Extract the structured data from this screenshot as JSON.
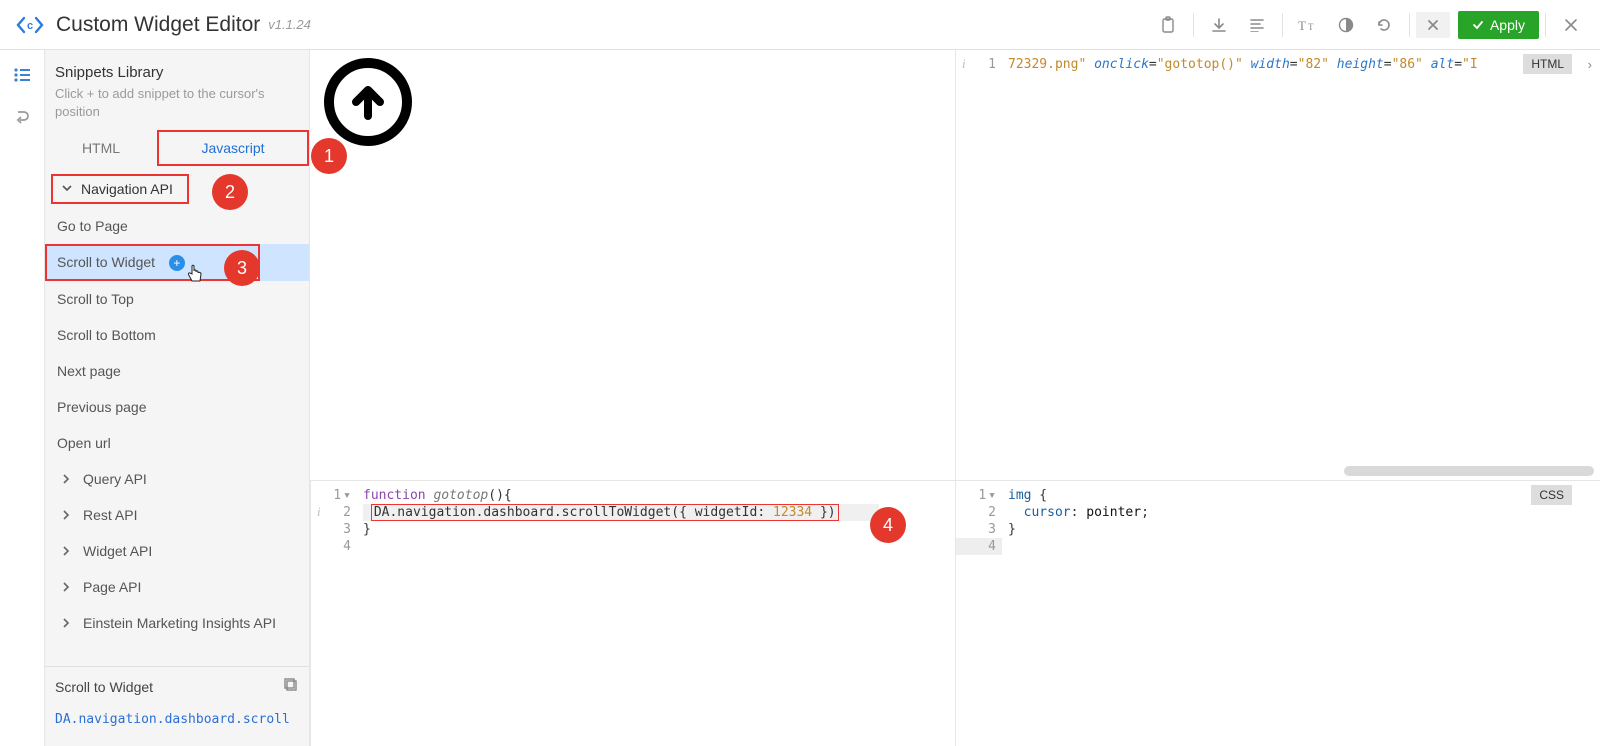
{
  "header": {
    "title": "Custom Widget Editor",
    "version": "v1.1.24",
    "apply_label": "Apply"
  },
  "sidebar": {
    "title": "Snippets Library",
    "hint": "Click + to add snippet to the cursor's position",
    "tabs": {
      "html": "HTML",
      "js": "Javascript"
    },
    "group_open": "Navigation API",
    "items": [
      "Go to Page",
      "Scroll to Widget",
      "Scroll to Top",
      "Scroll to Bottom",
      "Next page",
      "Previous page",
      "Open url"
    ],
    "groups_collapsed": [
      "Query API",
      "Rest API",
      "Widget API",
      "Page API",
      "Einstein Marketing Insights API"
    ],
    "footer": {
      "title": "Scroll to Widget",
      "code": "DA.navigation.dashboard.scroll"
    }
  },
  "callouts": {
    "c1": "1",
    "c2": "2",
    "c3": "3",
    "c4": "4"
  },
  "panes": {
    "html": {
      "badge": "HTML",
      "line1_plain": "72329.png\" onclick=\"gototop()\" width=\"82\" height=\"86\" alt=\"I\""
    },
    "js": {
      "lines": {
        "l1_kw": "function",
        "l1_fn": "gototop",
        "l1_tail": "(){",
        "l2_pre": "DA.navigation.dashboard.scrollToWidget({ widgetId: ",
        "l2_num": "12334",
        "l2_post": " })",
        "l3": "}",
        "l4": ""
      }
    },
    "css": {
      "badge": "CSS",
      "lines": {
        "l1": "img {",
        "l2_prop": "cursor",
        "l2_val": "pointer",
        "l3": "}",
        "l4": ""
      }
    }
  }
}
